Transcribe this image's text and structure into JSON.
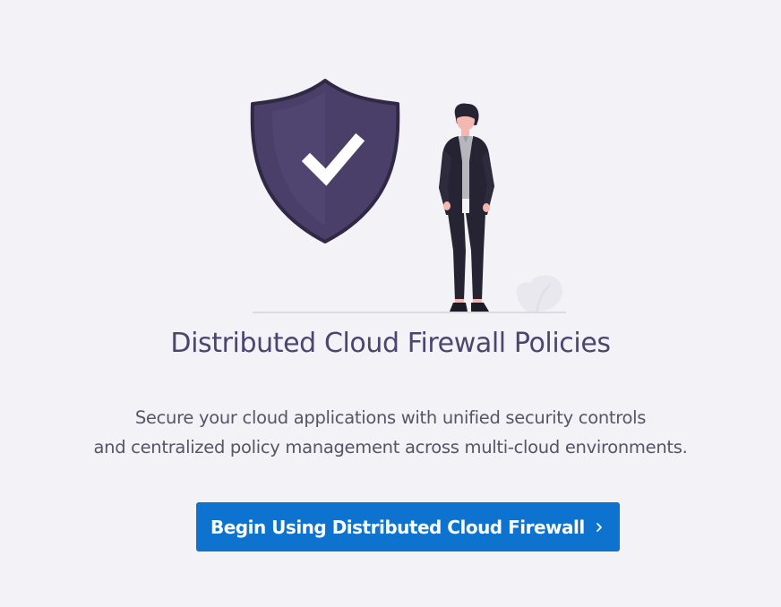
{
  "empty_state": {
    "title": "Distributed Cloud Firewall Policies",
    "description_lines": [
      "Secure your cloud applications with unified security controls",
      "and centralized policy management across multi-cloud environments."
    ],
    "cta_label": "Begin Using Distributed Cloud Firewall",
    "cta_icon": "chevron-right-icon"
  },
  "illustration": {
    "shield_icon": "shield-check-icon",
    "person": "standing-person",
    "plant": "plant-decoration"
  },
  "colors": {
    "background": "#f3f2f7",
    "shield": "#4a3f68",
    "title": "#4c456f",
    "cta": "#0e72cf"
  }
}
